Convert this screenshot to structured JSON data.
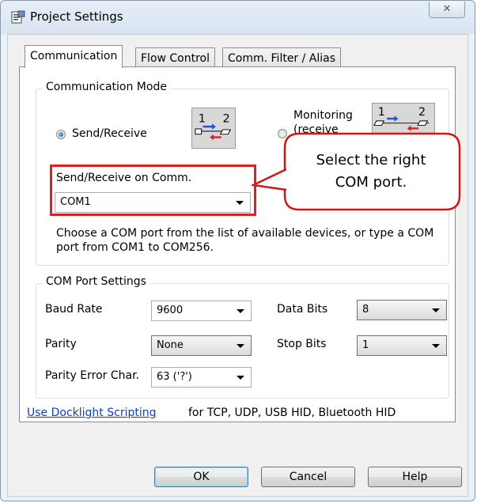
{
  "window": {
    "title": "Project Settings",
    "close_glyph": "✕"
  },
  "tabs": [
    {
      "label": "Communication",
      "active": true
    },
    {
      "label": "Flow Control",
      "active": false
    },
    {
      "label": "Comm. Filter / Alias",
      "active": false
    }
  ],
  "communication_mode": {
    "title": "Communication Mode",
    "send_receive_label": "Send/Receive",
    "send_receive_selected": true,
    "monitoring_label": "Monitoring",
    "monitoring_sublabel": "(receive",
    "monitoring_selected": false,
    "icon_left_1": "1",
    "icon_left_2": "2",
    "icon_right_1": "1",
    "icon_right_2": "2",
    "comm_label": "Send/Receive on Comm.",
    "comm_value": "COM1",
    "help_text": "Choose a COM port from the list of available devices, or type a COM port from COM1 to COM256."
  },
  "callout": {
    "text_line1": "Select the right",
    "text_line2": "COM port."
  },
  "com_port_settings": {
    "title": "COM Port Settings",
    "baud_rate_label": "Baud Rate",
    "baud_rate_value": "9600",
    "data_bits_label": "Data Bits",
    "data_bits_value": "8",
    "parity_label": "Parity",
    "parity_value": "None",
    "stop_bits_label": "Stop Bits",
    "stop_bits_value": "1",
    "parity_error_label": "Parity Error Char.",
    "parity_error_value": "63 ('?')"
  },
  "footer": {
    "link_text": "Use Docklight Scripting",
    "link_suffix": "for TCP, UDP, USB HID, Bluetooth HID"
  },
  "buttons": {
    "ok": "OK",
    "cancel": "Cancel",
    "help": "Help"
  },
  "colors": {
    "highlight": "#e0201e",
    "link": "#0b3fbd",
    "arrow_blue": "#1f4fe0",
    "arrow_red": "#e02020"
  }
}
